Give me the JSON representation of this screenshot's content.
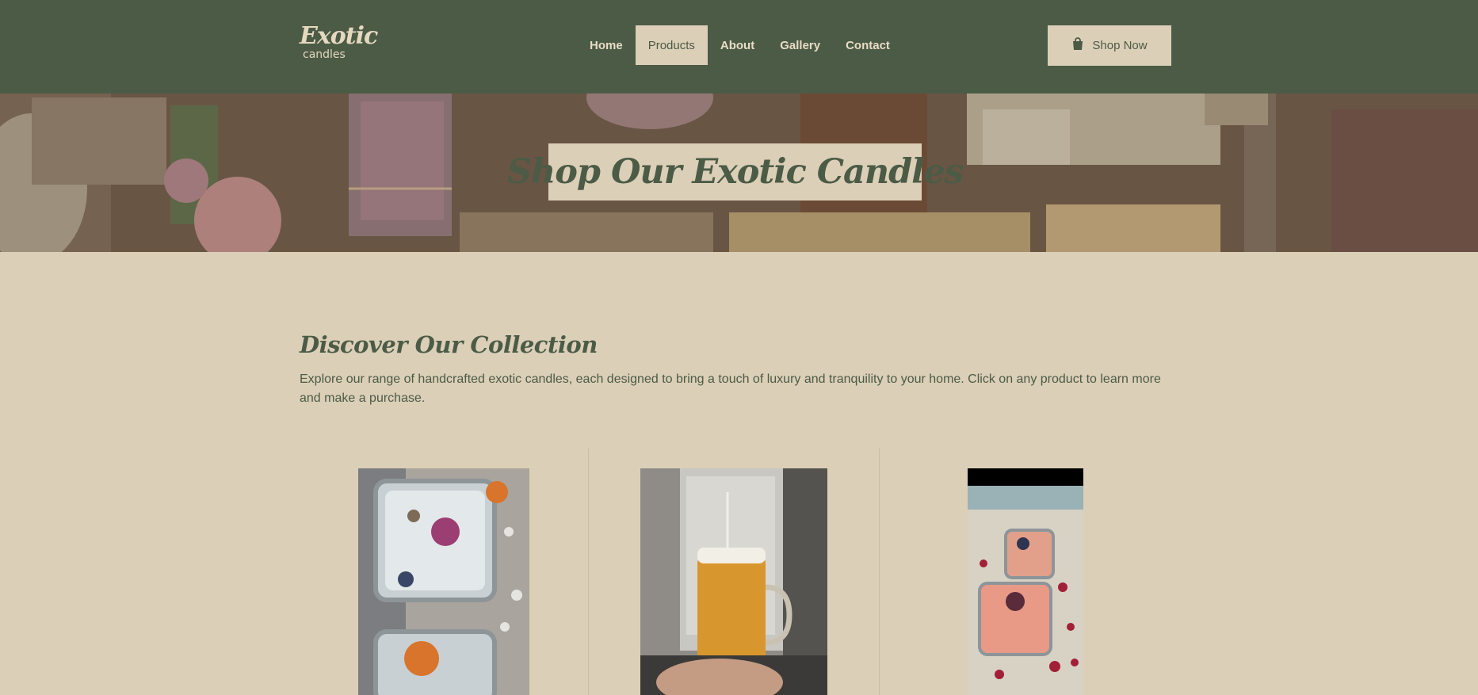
{
  "header": {
    "logo": {
      "main": "Exotic",
      "sub": "candles"
    },
    "nav": [
      {
        "label": "Home",
        "active": false
      },
      {
        "label": "Products",
        "active": true
      },
      {
        "label": "About",
        "active": false
      },
      {
        "label": "Gallery",
        "active": false
      },
      {
        "label": "Contact",
        "active": false
      }
    ],
    "shop_button": {
      "label": "Shop Now",
      "icon": "shopping-bag-icon"
    }
  },
  "hero": {
    "title": "Shop Our Exotic Candles"
  },
  "collection": {
    "title": "Discover Our Collection",
    "description": "Explore our range of handcrafted exotic candles, each designed to bring a touch of luxury and tranquility to your home. Click on any product to learn more and make a purchase.",
    "products": [
      {
        "image": "glass-jar-candles-with-dried-flowers"
      },
      {
        "image": "mug-candle-with-wick"
      },
      {
        "image": "pink-candles-with-rose-petals"
      }
    ]
  },
  "colors": {
    "header_bg": "#4b5b46",
    "page_bg": "#dccfb7",
    "accent_text": "#4b5b46",
    "nav_text": "#e8dcc6"
  }
}
